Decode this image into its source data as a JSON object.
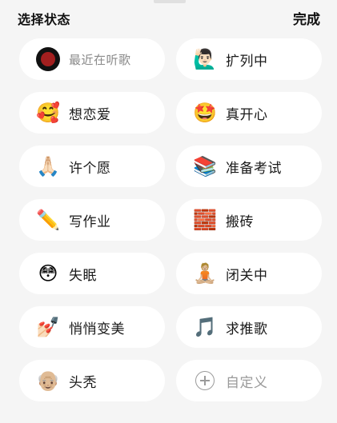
{
  "header": {
    "title": "选择状态",
    "done_label": "完成"
  },
  "statuses": [
    {
      "label": "最近在听歌",
      "icon": "record-icon",
      "emoji": ""
    },
    {
      "label": "扩列中",
      "icon": "person-raising-hand-icon",
      "emoji": "🙋🏻‍♂️"
    },
    {
      "label": "想恋爱",
      "icon": "smiling-face-with-hearts-icon",
      "emoji": "🥰"
    },
    {
      "label": "真开心",
      "icon": "star-struck-icon",
      "emoji": "🤩"
    },
    {
      "label": "许个愿",
      "icon": "folded-hands-icon",
      "emoji": "🙏🏻"
    },
    {
      "label": "准备考试",
      "icon": "books-icon",
      "emoji": "📚"
    },
    {
      "label": "写作业",
      "icon": "pencil-icon",
      "emoji": "✏️"
    },
    {
      "label": "搬砖",
      "icon": "brick-icon",
      "emoji": "🧱"
    },
    {
      "label": "失眠",
      "icon": "flushed-face-icon",
      "emoji": "😳"
    },
    {
      "label": "闭关中",
      "icon": "person-in-lotus-position-icon",
      "emoji": "🧘🏼"
    },
    {
      "label": "悄悄变美",
      "icon": "nail-polish-icon",
      "emoji": "💅🏻"
    },
    {
      "label": "求推歌",
      "icon": "musical-note-icon",
      "emoji": "🎵"
    },
    {
      "label": "头秃",
      "icon": "older-man-icon",
      "emoji": "👴🏼"
    },
    {
      "label": "自定义",
      "icon": "plus-circle-icon",
      "emoji": ""
    }
  ]
}
